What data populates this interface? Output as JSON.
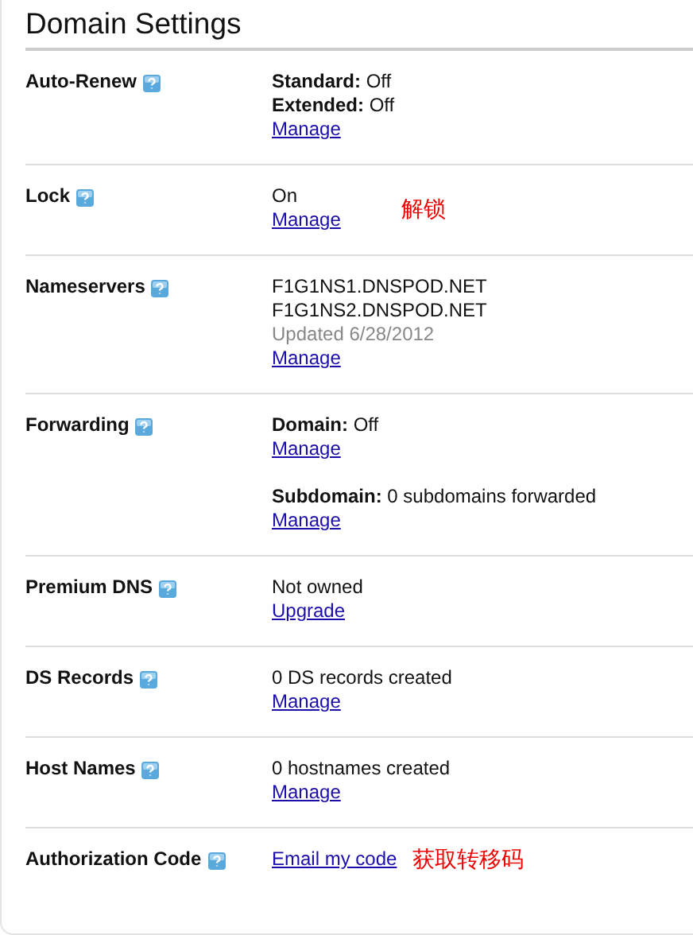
{
  "title": "Domain Settings",
  "rows": [
    {
      "label": "Auto-Renew",
      "lines": [
        {
          "kind": "text",
          "text": "**Standard:** Off"
        },
        {
          "kind": "text",
          "text": "**Extended:** Off"
        },
        {
          "kind": "link",
          "text": "Manage"
        }
      ]
    },
    {
      "label": "Lock",
      "lines": [
        {
          "kind": "text",
          "text": "On"
        },
        {
          "kind": "link",
          "text": "Manage"
        }
      ],
      "note": "解锁"
    },
    {
      "label": "Nameservers",
      "lines": [
        {
          "kind": "text",
          "text": "F1G1NS1.DNSPOD.NET"
        },
        {
          "kind": "text",
          "text": "F1G1NS2.DNSPOD.NET"
        },
        {
          "kind": "muted",
          "text": "Updated 6/28/2012"
        },
        {
          "kind": "link",
          "text": "Manage"
        }
      ]
    },
    {
      "label": "Forwarding",
      "lines": [
        {
          "kind": "text",
          "text": "**Domain:** Off"
        },
        {
          "kind": "link",
          "text": "Manage"
        },
        {
          "kind": "text",
          "text": "**Subdomain:** 0 subdomains forwarded",
          "gap": true
        },
        {
          "kind": "link",
          "text": "Manage"
        }
      ]
    },
    {
      "label": "Premium DNS",
      "lines": [
        {
          "kind": "text",
          "text": "Not owned"
        },
        {
          "kind": "link",
          "text": "Upgrade"
        }
      ]
    },
    {
      "label": "DS Records",
      "lines": [
        {
          "kind": "text",
          "text": "0 DS records created"
        },
        {
          "kind": "link",
          "text": "Manage"
        }
      ]
    },
    {
      "label": "Host Names",
      "lines": [
        {
          "kind": "text",
          "text": "0 hostnames created"
        },
        {
          "kind": "link",
          "text": "Manage"
        }
      ]
    },
    {
      "label": "Authorization Code",
      "lines": [
        {
          "kind": "link",
          "text": "Email my code"
        }
      ],
      "note": "获取转移码"
    }
  ]
}
